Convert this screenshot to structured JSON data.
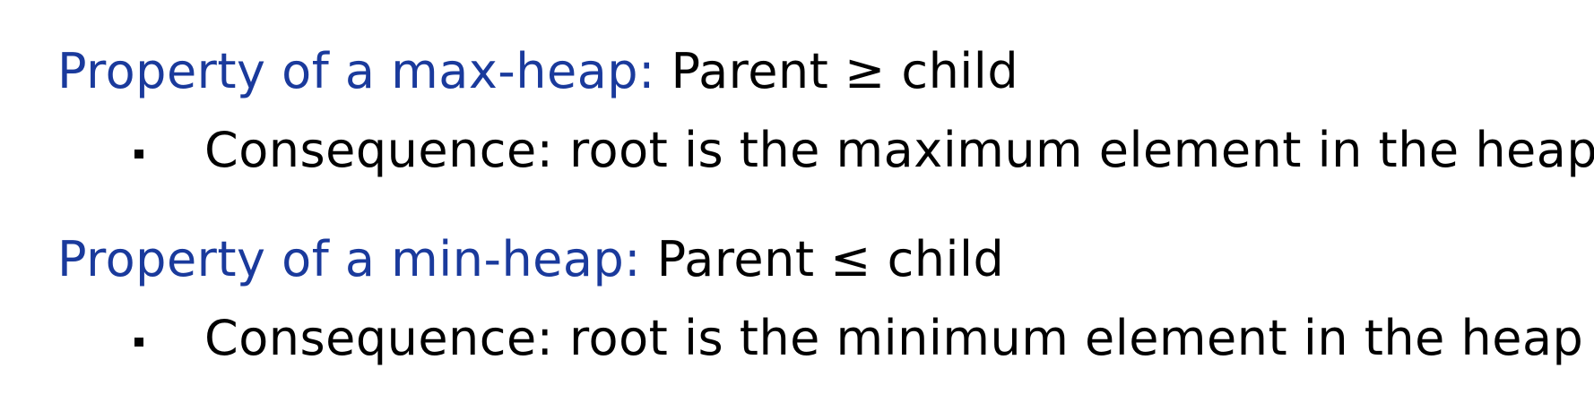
{
  "max_heap": {
    "label": "Property of a max-heap:",
    "rule": "Parent ≥ child",
    "consequence": "Consequence: root is the maximum element in the heap"
  },
  "min_heap": {
    "label": "Property of a min-heap:",
    "rule": "Parent ≤ child",
    "consequence": "Consequence: root is the minimum element in the heap"
  },
  "colors": {
    "heading_label": "#1a3a9c",
    "text": "#000000"
  }
}
